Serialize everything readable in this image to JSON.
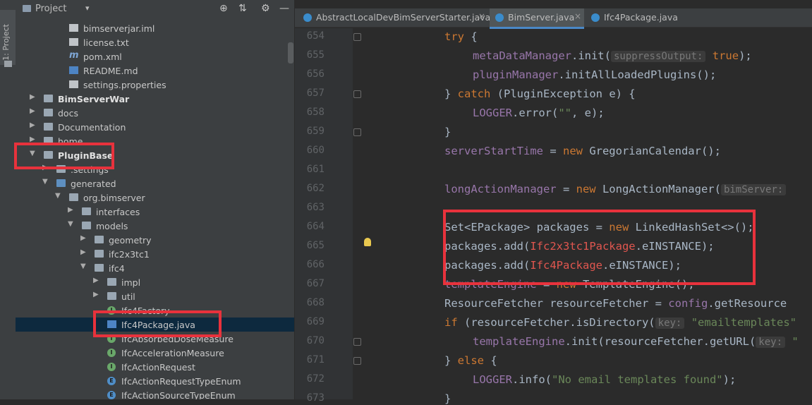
{
  "sidebar_strip": {
    "label": "1: Project"
  },
  "project_panel": {
    "title": "Project",
    "caret": "▾",
    "buttons": [
      "⊕",
      "⇅",
      "⚙",
      "—"
    ]
  },
  "tree": [
    {
      "label": "bimserverjar.iml",
      "indent": 56,
      "icon": "file"
    },
    {
      "label": "license.txt",
      "indent": 56,
      "icon": "file"
    },
    {
      "label": "pom.xml",
      "indent": 56,
      "icon": "maven",
      "glyph": "m"
    },
    {
      "label": "README.md",
      "indent": 56,
      "icon": "md"
    },
    {
      "label": "settings.properties",
      "indent": 56,
      "icon": "file"
    },
    {
      "label": "BimServerWar",
      "indent": 20,
      "icon": "module",
      "arrow": "▶",
      "bold": true
    },
    {
      "label": "docs",
      "indent": 20,
      "icon": "folder",
      "arrow": "▶"
    },
    {
      "label": "Documentation",
      "indent": 20,
      "icon": "folder",
      "arrow": "▶"
    },
    {
      "label": "home",
      "indent": 20,
      "icon": "folder",
      "arrow": "▶"
    },
    {
      "label": "PluginBase",
      "indent": 20,
      "icon": "module",
      "arrow": "▼",
      "bold": true
    },
    {
      "label": ".settings",
      "indent": 38,
      "icon": "folder",
      "arrow": "▶"
    },
    {
      "label": "generated",
      "indent": 38,
      "icon": "folder-blue",
      "arrow": "▼"
    },
    {
      "label": "org.bimserver",
      "indent": 56,
      "icon": "folder",
      "arrow": "▼"
    },
    {
      "label": "interfaces",
      "indent": 74,
      "icon": "folder",
      "arrow": "▶"
    },
    {
      "label": "models",
      "indent": 74,
      "icon": "folder",
      "arrow": "▼"
    },
    {
      "label": "geometry",
      "indent": 92,
      "icon": "folder",
      "arrow": "▶"
    },
    {
      "label": "ifc2x3tc1",
      "indent": 92,
      "icon": "folder",
      "arrow": "▶"
    },
    {
      "label": "ifc4",
      "indent": 92,
      "icon": "folder",
      "arrow": "▼"
    },
    {
      "label": "impl",
      "indent": 110,
      "icon": "folder",
      "arrow": "▶"
    },
    {
      "label": "util",
      "indent": 110,
      "icon": "folder",
      "arrow": "▶"
    },
    {
      "label": "Ifc4Factory",
      "indent": 110,
      "icon": "interface",
      "glyph": "I"
    },
    {
      "label": "Ifc4Package.java",
      "indent": 110,
      "icon": "java",
      "selected": true
    },
    {
      "label": "IfcAbsorbedDoseMeasure",
      "indent": 110,
      "icon": "interface",
      "glyph": "I"
    },
    {
      "label": "IfcAccelerationMeasure",
      "indent": 110,
      "icon": "interface",
      "glyph": "I"
    },
    {
      "label": "IfcActionRequest",
      "indent": 110,
      "icon": "interface",
      "glyph": "I"
    },
    {
      "label": "IfcActionRequestTypeEnum",
      "indent": 110,
      "icon": "enum",
      "glyph": "E"
    },
    {
      "label": "IfcActionSourceTypeEnum",
      "indent": 110,
      "icon": "enum",
      "glyph": "E"
    }
  ],
  "tabs": [
    {
      "label": "AbstractLocalDevBimServerStarter.java",
      "close": "×"
    },
    {
      "label": "BimServer.java",
      "close": "×",
      "active": true
    },
    {
      "label": "Ifc4Package.java",
      "close": ""
    }
  ],
  "line_numbers": [
    "654",
    "655",
    "656",
    "657",
    "658",
    "659",
    "660",
    "661",
    "662",
    "663",
    "664",
    "665",
    "666",
    "667",
    "668",
    "669",
    "670",
    "671",
    "672",
    "673"
  ],
  "code_lines": [
    {
      "indent": 0,
      "parts": [
        [
          "kw",
          "try"
        ],
        [
          "",
          "{"
        ]
      ]
    },
    {
      "indent": 1,
      "parts": [
        [
          "fld",
          "metaDataManager"
        ],
        [
          "",
          ".init("
        ],
        [
          "hint",
          "suppressOutput:"
        ],
        [
          "kw",
          " true"
        ],
        [
          "",
          ");"
        ]
      ]
    },
    {
      "indent": 1,
      "parts": [
        [
          "fld",
          "pluginManager"
        ],
        [
          "",
          ".initAllLoadedPlugins();"
        ]
      ]
    },
    {
      "indent": 0,
      "parts": [
        [
          "",
          "} "
        ],
        [
          "kw",
          "catch"
        ],
        [
          "",
          " (PluginException e) {"
        ]
      ]
    },
    {
      "indent": 1,
      "parts": [
        [
          "fld",
          "LOGGER"
        ],
        [
          "",
          ".error("
        ],
        [
          "str",
          "\"\""
        ],
        [
          "",
          ", e);"
        ]
      ]
    },
    {
      "indent": 0,
      "parts": [
        [
          "",
          "}"
        ]
      ]
    },
    {
      "indent": 0,
      "parts": [
        [
          "fld",
          "serverStartTime"
        ],
        [
          "",
          " = "
        ],
        [
          "kw",
          "new"
        ],
        [
          "",
          " GregorianCalendar();"
        ]
      ]
    },
    {
      "indent": 0,
      "parts": []
    },
    {
      "indent": 0,
      "parts": [
        [
          "fld",
          "longActionManager"
        ],
        [
          "",
          " = "
        ],
        [
          "kw",
          "new"
        ],
        [
          "",
          " LongActionManager("
        ],
        [
          "hint",
          "bimServer:"
        ]
      ]
    },
    {
      "indent": 0,
      "parts": []
    },
    {
      "indent": 0,
      "parts": [
        [
          "",
          "Set<EPackage> packages = "
        ],
        [
          "kw",
          "new"
        ],
        [
          "",
          " LinkedHashSet<>();"
        ]
      ]
    },
    {
      "indent": 0,
      "parts": [
        [
          "",
          "packages.add("
        ],
        [
          "red",
          "Ifc2x3tc1Package"
        ],
        [
          "",
          ".eINSTANCE);"
        ]
      ]
    },
    {
      "indent": 0,
      "parts": [
        [
          "",
          "packages.add("
        ],
        [
          "red",
          "Ifc4Package"
        ],
        [
          "",
          ".eINSTANCE);"
        ]
      ]
    },
    {
      "indent": 0,
      "parts": [
        [
          "fld",
          "templateEngine"
        ],
        [
          "",
          " = "
        ],
        [
          "kw",
          "new"
        ],
        [
          "",
          " TemplateEngine();"
        ]
      ]
    },
    {
      "indent": 0,
      "parts": [
        [
          "",
          "ResourceFetcher resourceFetcher = "
        ],
        [
          "fld",
          "config"
        ],
        [
          "",
          ".getResource"
        ]
      ]
    },
    {
      "indent": 0,
      "parts": [
        [
          "kw",
          "if"
        ],
        [
          "",
          " (resourceFetcher.isDirectory("
        ],
        [
          "hint",
          "key:"
        ],
        [
          "str",
          " \"emailtemplates\""
        ]
      ]
    },
    {
      "indent": 1,
      "parts": [
        [
          "fld",
          "templateEngine"
        ],
        [
          "",
          ".init(resourceFetcher.getURL("
        ],
        [
          "hint",
          "key:"
        ],
        [
          "str",
          " \""
        ]
      ]
    },
    {
      "indent": 0,
      "parts": [
        [
          "",
          "} "
        ],
        [
          "kw",
          "else"
        ],
        [
          "",
          " {"
        ]
      ]
    },
    {
      "indent": 1,
      "parts": [
        [
          "fld",
          "LOGGER"
        ],
        [
          "",
          ".info("
        ],
        [
          "str",
          "\"No email templates found\""
        ],
        [
          "",
          ");"
        ]
      ]
    },
    {
      "indent": 0,
      "parts": [
        [
          "",
          "}"
        ]
      ]
    }
  ],
  "colors": {
    "keyword": "#cc7832",
    "field": "#9876aa",
    "string": "#6a8759",
    "callout": "#e8323c",
    "selection": "#0d293e"
  }
}
